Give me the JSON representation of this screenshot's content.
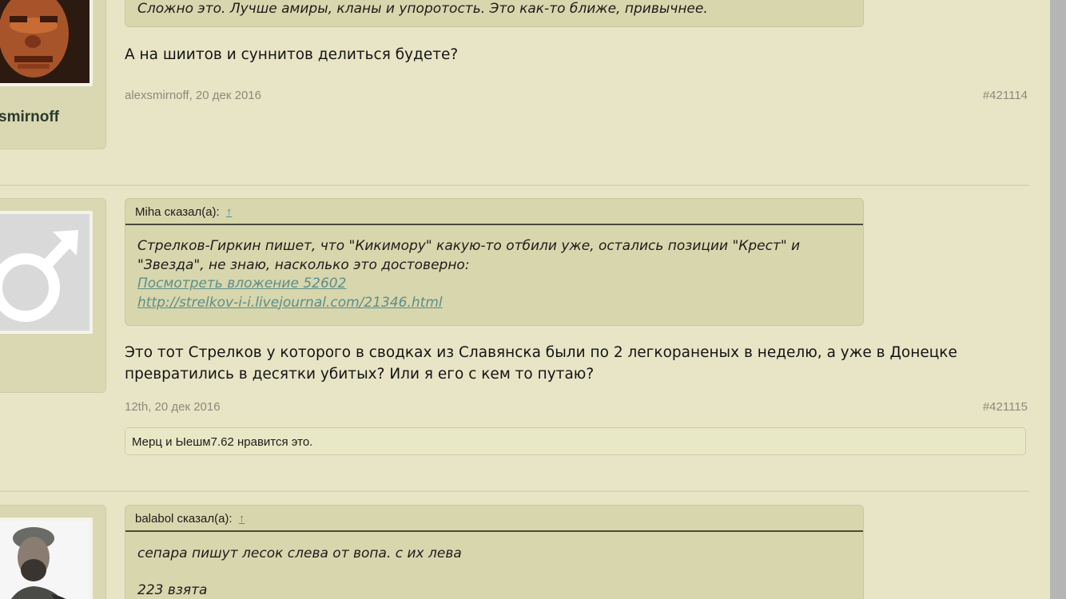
{
  "posts": [
    {
      "username": "smirnoff",
      "quote_tail": "Сложно это. Лучше амиры, кланы и упоротость. Это как-то ближе, привычнее.",
      "message": "А на шиитов и суннитов делиться будете?",
      "author_date": "alexsmirnoff, 20 дек 2016",
      "number": "#421114",
      "avatar_icon": "doom-face-avatar"
    },
    {
      "username": "",
      "quote_author": "Miha сказал(а):",
      "quote_arrow": "↑",
      "quote_line1": "Стрелков-Гиркин пишет, что \"Кикимору\" какую-то отбили уже, остались позиции \"Крест\" и",
      "quote_line2": "\"Звезда\", не знаю, насколько это достоверно:",
      "quote_link1": "Посмотреть вложение 52602",
      "quote_link2": "http://strelkov-i-i.livejournal.com/21346.html",
      "message_line1": "Это тот Стрелков у которого в сводках из Славянска были по 2 легкораненых в неделю, а уже в Донецке",
      "message_line2": "превратились в десятки убитых? Или я его с кем то путаю?",
      "author_date": "12th, 20 дек 2016",
      "number": "#421115",
      "likes": "Мерц и Ыешм7.62 нравится это.",
      "avatar_icon": "male-symbol-avatar"
    },
    {
      "quote_author": "balabol сказал(а):",
      "quote_arrow": "↑",
      "quote_line1": "сепара пишут лесок слева от вопа. с их лева",
      "quote_line2": "223 взята",
      "avatar_icon": "man-photo-avatar"
    }
  ],
  "colors": {
    "background": "#e7e5c6",
    "user_box": "#d9d8b2",
    "quote_bg": "#d8d6ad",
    "link": "#5c8f88",
    "meta": "#8b8b7a"
  }
}
